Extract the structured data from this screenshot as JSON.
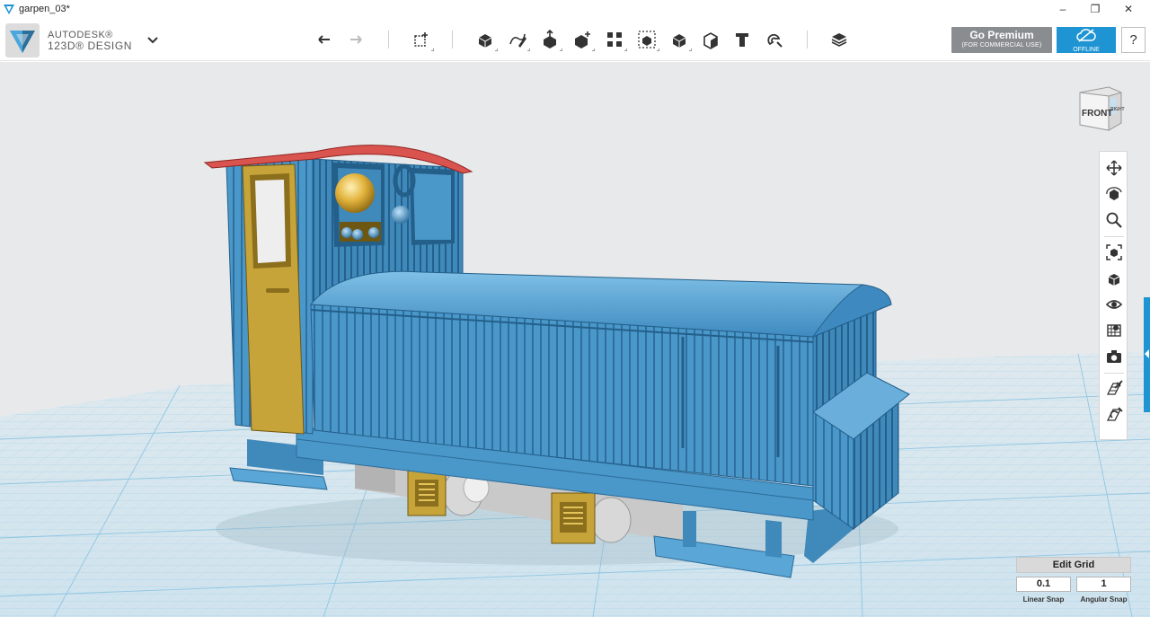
{
  "window": {
    "title": "garpen_03*",
    "controls": [
      "–",
      "❐",
      "✕"
    ]
  },
  "brand": {
    "line1": "AUTODESK®",
    "line2": "123D® DESIGN"
  },
  "toolbar": {
    "tools": [
      "undo-icon",
      "redo-icon",
      "transform-icon",
      "primitives-icon",
      "sketch-icon",
      "construct-icon",
      "modify-icon",
      "pattern-icon",
      "grouping-icon",
      "combine-icon",
      "measure-icon",
      "text-icon",
      "snap-icon",
      "material-icon"
    ]
  },
  "premium": {
    "label": "Go Premium",
    "sublabel": "(FOR COMMERCIAL USE)"
  },
  "offline": {
    "label": "OFFLINE"
  },
  "help": {
    "label": "?"
  },
  "viewcube": {
    "front": "FRONT",
    "right": "RIGHT"
  },
  "nav": {
    "tools": [
      "pan-icon",
      "orbit-icon",
      "zoom-icon",
      "fit-icon",
      "view-icon",
      "visibility-icon",
      "materials-icon",
      "screenshot-icon",
      "grid-toggle-icon",
      "snap-toggle-icon"
    ]
  },
  "edit_grid": {
    "title": "Edit Grid",
    "linear_value": "0.1",
    "angular_value": "1",
    "linear_label": "Linear Snap",
    "angular_label": "Angular Snap"
  },
  "colors": {
    "accent": "#1e94d2",
    "premium": "#8a8d90",
    "model_blue": "#4a97c9",
    "model_gold": "#c7a43a",
    "model_red": "#d9534f"
  }
}
